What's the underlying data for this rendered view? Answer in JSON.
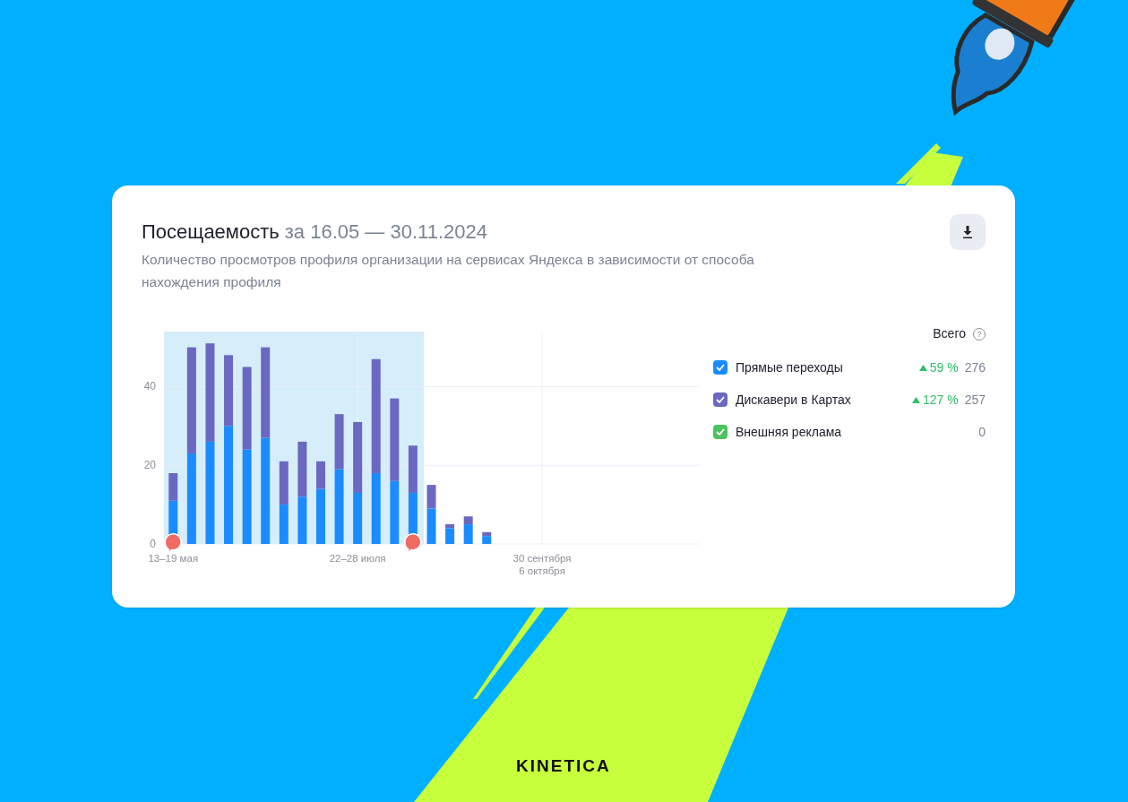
{
  "card": {
    "title": "Посещаемость",
    "period": "за 16.05 — 30.11.2024",
    "description": "Количество просмотров профиля организации на сервисах Яндекса в зависимости от способа нахождения профиля",
    "chart_data": {
      "type": "bar",
      "stacked": true,
      "grid": true,
      "ylim": [
        0,
        54
      ],
      "yticks": [
        0,
        20,
        40
      ],
      "categories": [
        "13–19 мая",
        null,
        null,
        null,
        null,
        null,
        null,
        null,
        null,
        null,
        "22–28 июля",
        null,
        null,
        null,
        null,
        null,
        null,
        null,
        null,
        null,
        "30 сентября\n6 октября",
        null,
        null,
        null,
        null,
        null,
        null,
        null,
        null
      ],
      "series": [
        {
          "name": "Прямые переходы",
          "color": "#1a8cff",
          "values": [
            11,
            23,
            26,
            30,
            24,
            27,
            10,
            12,
            14,
            19,
            13,
            18,
            16,
            13,
            9,
            4,
            5,
            2,
            0,
            0,
            0,
            0,
            0,
            0,
            0,
            0,
            0,
            0,
            0
          ]
        },
        {
          "name": "Дискавери в Картах",
          "color": "#6b68c2",
          "values": [
            7,
            27,
            25,
            18,
            21,
            23,
            11,
            14,
            7,
            14,
            18,
            29,
            21,
            12,
            6,
            1,
            2,
            1,
            0,
            0,
            0,
            0,
            0,
            0,
            0,
            0,
            0,
            0,
            0
          ]
        },
        {
          "name": "Внешняя реклама",
          "color": "#4cc25e",
          "values": [
            0,
            0,
            0,
            0,
            0,
            0,
            0,
            0,
            0,
            0,
            0,
            0,
            0,
            0,
            0,
            0,
            0,
            0,
            0,
            0,
            0,
            0,
            0,
            0,
            0,
            0,
            0,
            0,
            0
          ]
        }
      ]
    },
    "legend": {
      "heading": "Всего",
      "help": "?",
      "items": [
        {
          "checked": true,
          "change": "59 %",
          "total": "276"
        },
        {
          "checked": true,
          "change": "127 %",
          "total": "257"
        },
        {
          "checked": true,
          "total": "0"
        }
      ]
    }
  },
  "brand": "KINETICA"
}
